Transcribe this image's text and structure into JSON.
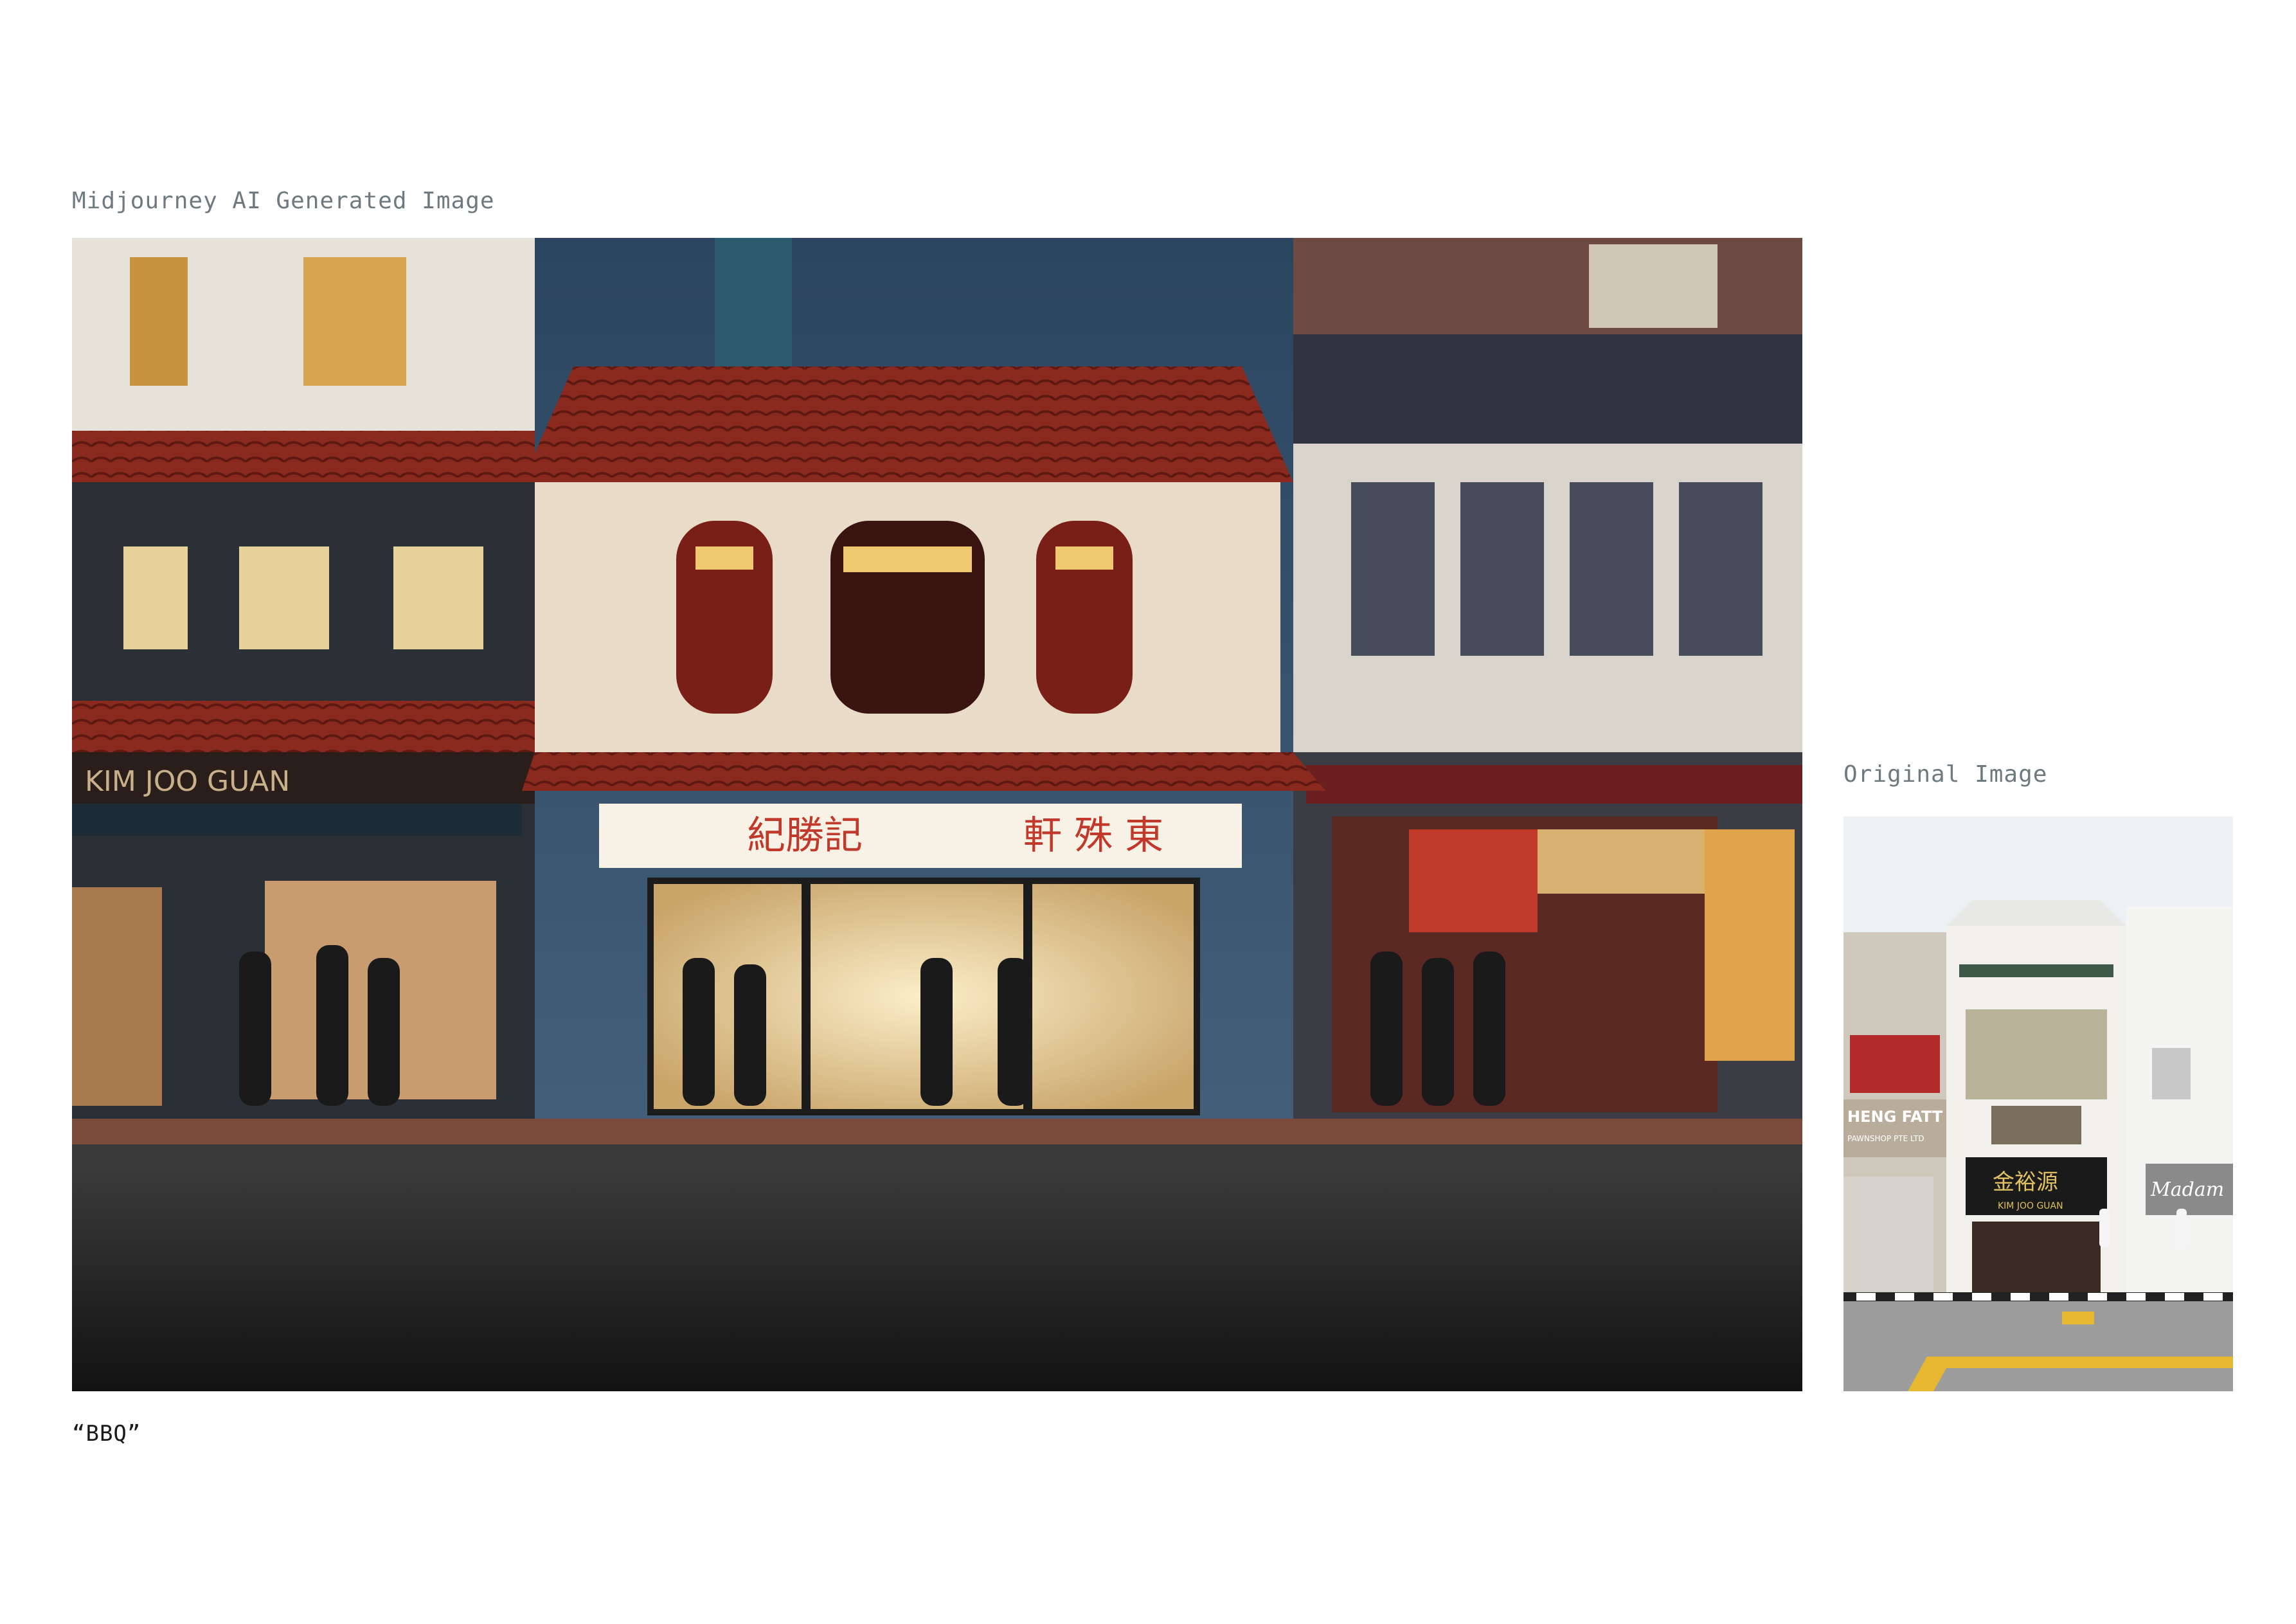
{
  "generated": {
    "label": "Midjourney AI Generated Image",
    "caption": "“BBQ”",
    "signboard_left": "紀勝記",
    "signboard_right": "軒 殊 東",
    "left_shop_sign": "KIM JOO GUAN"
  },
  "original": {
    "label": "Original Image",
    "left_shop_sign": "HENG FATT",
    "left_shop_sub": "PAWNSHOP PTE LTD",
    "center_sign_cn": "金裕源",
    "center_sign_en": "KIM JOO GUAN",
    "right_shop_sign": "Madam"
  },
  "colors": {
    "roof_red": "#8a2a1e",
    "night_sky": "#2c4560",
    "shop_glow": "#f3dfb0"
  }
}
